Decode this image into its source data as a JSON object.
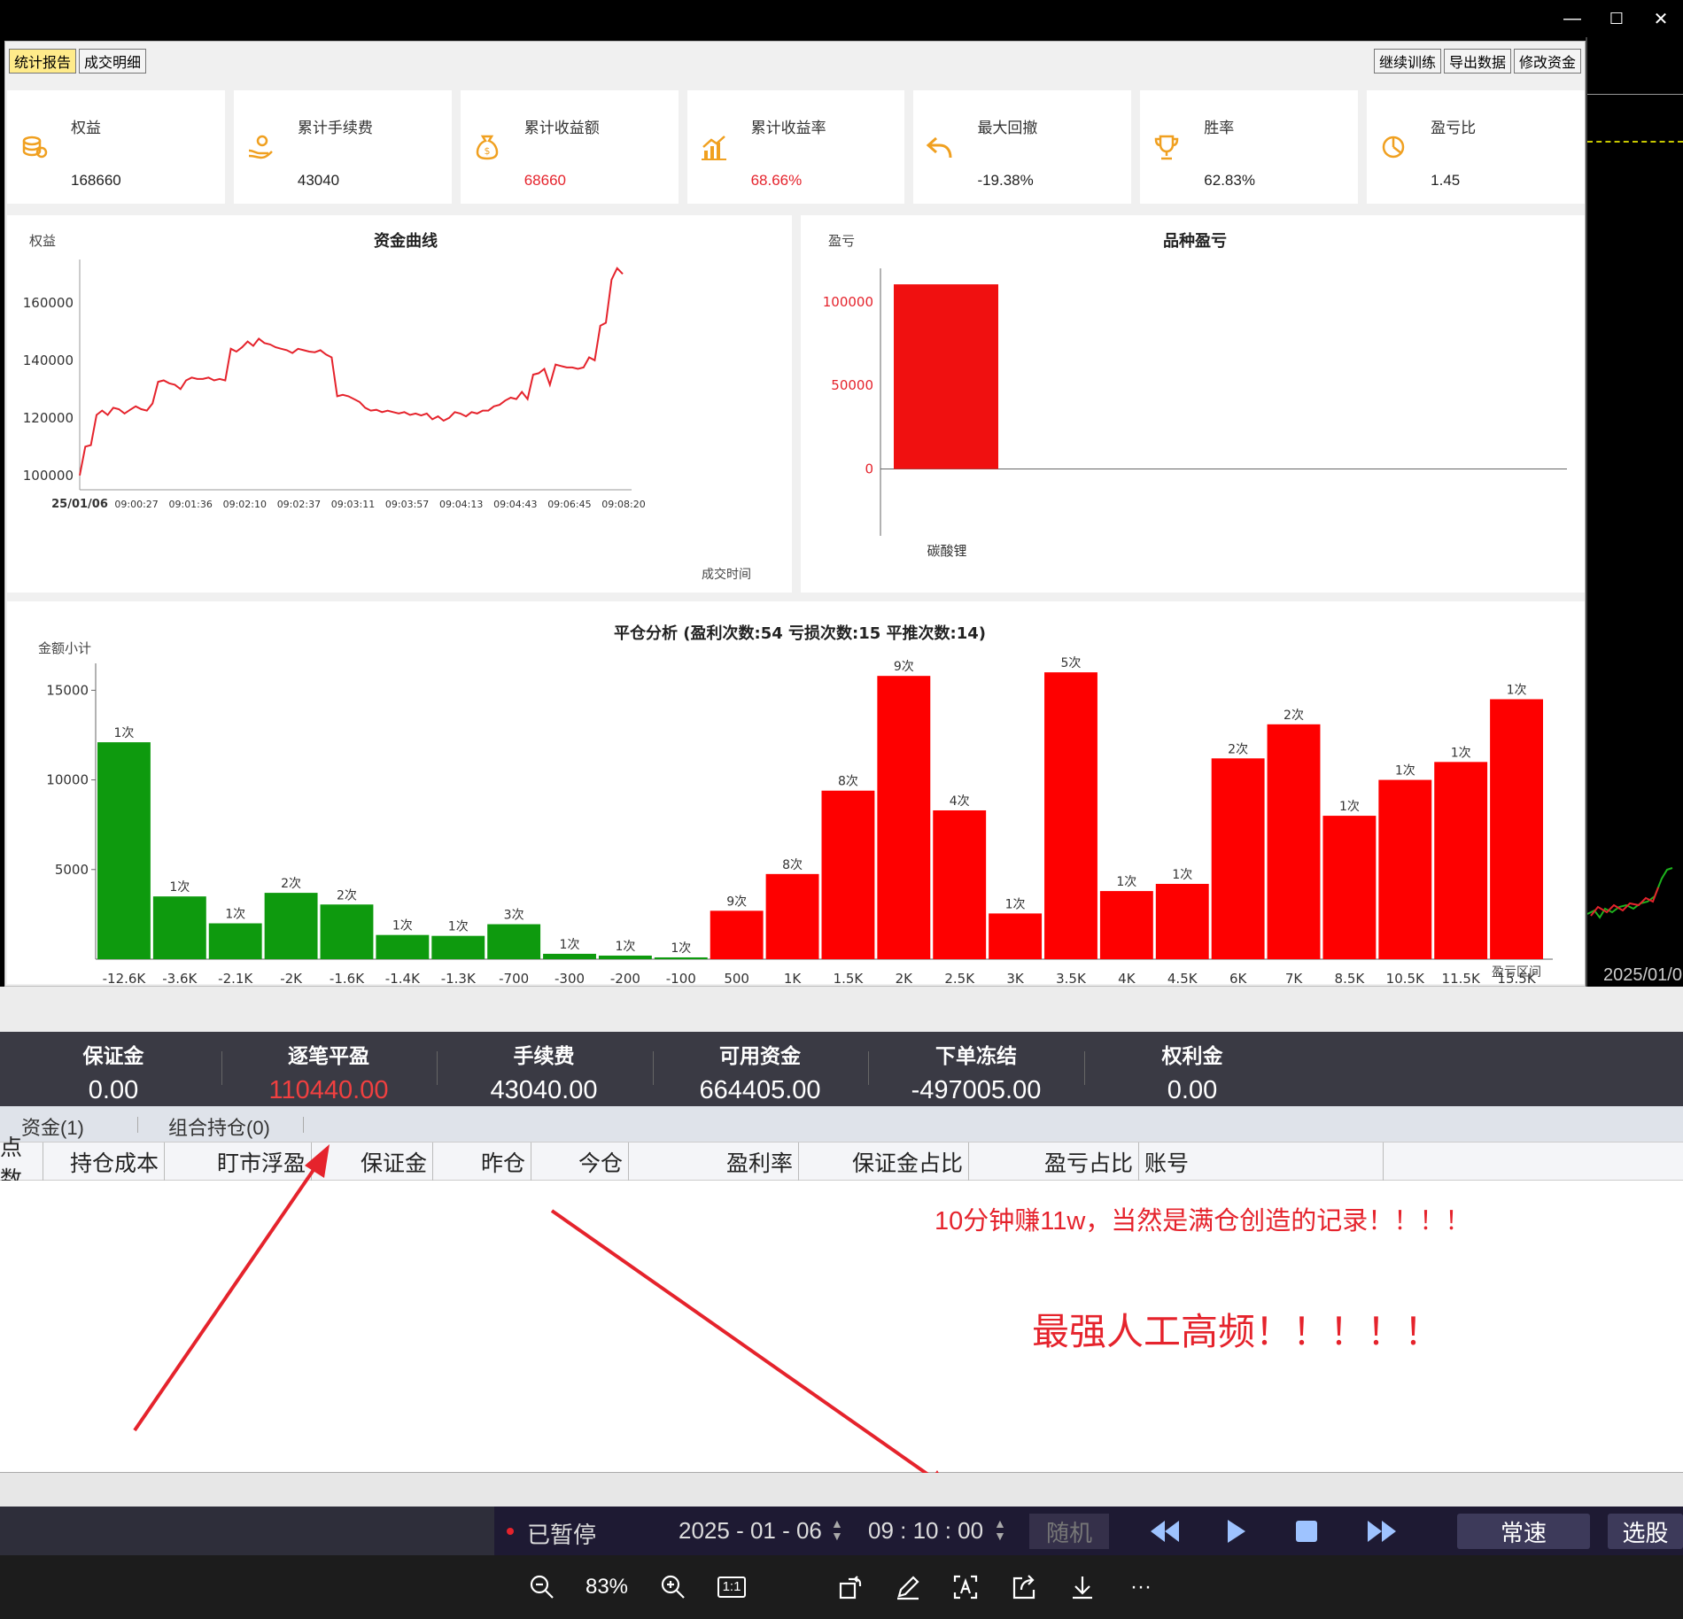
{
  "window": {
    "minimize": "—",
    "maximize": "☐",
    "close": "✕"
  },
  "side": {
    "date": "2025/01/0"
  },
  "report": {
    "tabs": [
      "统计报告",
      "成交明细"
    ],
    "actions": [
      "继续训练",
      "导出数据",
      "修改资金"
    ],
    "stats": [
      {
        "label": "权益",
        "value": "168660",
        "icon": "coins-icon",
        "red": false
      },
      {
        "label": "累计手续费",
        "value": "43040",
        "icon": "hand-coins-icon",
        "red": false
      },
      {
        "label": "累计收益额",
        "value": "68660",
        "icon": "money-bag-icon",
        "red": true
      },
      {
        "label": "累计收益率",
        "value": "68.66%",
        "icon": "growth-chart-icon",
        "red": true
      },
      {
        "label": "最大回撤",
        "value": "-19.38%",
        "icon": "undo-arrow-icon",
        "red": false
      },
      {
        "label": "胜率",
        "value": "62.83%",
        "icon": "trophy-icon",
        "red": false
      },
      {
        "label": "盈亏比",
        "value": "1.45",
        "icon": "pie-icon",
        "red": false
      }
    ],
    "accent": "#f0a020"
  },
  "chart_data": [
    {
      "type": "line",
      "title": "资金曲线",
      "ylabel": "权益",
      "xlabel": "成交时间",
      "ylim": [
        95000,
        175000
      ],
      "yticks": [
        100000,
        120000,
        140000,
        160000
      ],
      "xticks": [
        "25/01/06",
        "09:00:27",
        "09:01:36",
        "09:02:10",
        "09:02:37",
        "09:03:11",
        "09:03:57",
        "09:04:13",
        "09:04:43",
        "09:06:45",
        "09:08:20"
      ],
      "color": "#e5232c",
      "values": [
        100000,
        110000,
        110500,
        121000,
        122500,
        121000,
        123500,
        123000,
        121500,
        122800,
        124000,
        123000,
        122500,
        125000,
        132500,
        133000,
        132000,
        131500,
        130000,
        133000,
        134000,
        133500,
        133500,
        134000,
        133000,
        133500,
        133000,
        144000,
        143000,
        144500,
        146500,
        145000,
        147500,
        146000,
        145500,
        144500,
        144000,
        143500,
        142500,
        144000,
        143500,
        143000,
        142800,
        143500,
        142000,
        141000,
        127500,
        128000,
        127500,
        126500,
        125500,
        123500,
        122500,
        122800,
        122000,
        122500,
        122000,
        121500,
        122000,
        121000,
        121500,
        120800,
        121500,
        119500,
        120500,
        119000,
        120000,
        122000,
        121500,
        120500,
        122000,
        121500,
        122500,
        122500,
        124000,
        124500,
        126000,
        127000,
        126500,
        129000,
        126500,
        135000,
        135500,
        137000,
        131500,
        138500,
        138000,
        137500,
        137500,
        137000,
        137500,
        141000,
        140000,
        152000,
        153000,
        168000,
        172000,
        170000
      ]
    },
    {
      "type": "bar",
      "title": "品种盈亏",
      "ylabel": "盈亏",
      "categories": [
        "碳酸锂"
      ],
      "values": [
        110440
      ],
      "ylim": [
        -40000,
        120000
      ],
      "yticks": [
        0,
        50000,
        100000
      ],
      "color": "#f01010"
    },
    {
      "type": "bar",
      "title": "平仓分析 (盈利次数:54 亏损次数:15 平推次数:14)",
      "ylabel": "金额小计",
      "xlabel": "盈亏区间",
      "ylim": [
        0,
        16500
      ],
      "yticks": [
        5000,
        10000,
        15000
      ],
      "categories": [
        "-12.6K",
        "-3.6K",
        "-2.1K",
        "-2K",
        "-1.6K",
        "-1.4K",
        "-1.3K",
        "-700",
        "-300",
        "-200",
        "-100",
        "500",
        "1K",
        "1.5K",
        "2K",
        "2.5K",
        "3K",
        "3.5K",
        "4K",
        "4.5K",
        "6K",
        "7K",
        "8.5K",
        "10.5K",
        "11.5K",
        "15.5K"
      ],
      "values": [
        12100,
        3500,
        2000,
        3700,
        3050,
        1350,
        1300,
        1950,
        300,
        200,
        100,
        2700,
        4750,
        9400,
        15800,
        8300,
        2550,
        16000,
        3800,
        4200,
        11200,
        13100,
        8000,
        10000,
        11000,
        14500
      ],
      "counts": [
        "1次",
        "1次",
        "1次",
        "2次",
        "2次",
        "1次",
        "1次",
        "3次",
        "1次",
        "1次",
        "1次",
        "9次",
        "8次",
        "8次",
        "9次",
        "4次",
        "1次",
        "5次",
        "1次",
        "1次",
        "2次",
        "2次",
        "1次",
        "1次",
        "1次",
        "1次"
      ],
      "loss_color": "#0e9a0e",
      "gain_color": "#fe0000"
    }
  ],
  "summary": [
    {
      "label": "保证金",
      "value": "0.00",
      "red": false
    },
    {
      "label": "逐笔平盈",
      "value": "110440.00",
      "red": true
    },
    {
      "label": "手续费",
      "value": "43040.00",
      "red": false
    },
    {
      "label": "可用资金",
      "value": "664405.00",
      "red": false
    },
    {
      "label": "下单冻结",
      "value": "-497005.00",
      "red": false
    },
    {
      "label": "权利金",
      "value": "0.00",
      "red": false
    }
  ],
  "bottom_tabs": [
    "资金(1)",
    "组合持仓(0)"
  ],
  "columns": [
    "点数",
    "持仓成本",
    "盯市浮盈",
    "保证金",
    "昨仓",
    "今仓",
    "盈利率",
    "保证金占比",
    "盈亏占比",
    "账号"
  ],
  "annotations": {
    "line1": "10分钟赚11w，当然是满仓创造的记录！！！！",
    "line2": "最强人工高频！！！！！"
  },
  "playbar": {
    "status": "已暂停",
    "date": "2025 - 01 - 06",
    "time": "09 : 10 : 00",
    "random": "随机",
    "speed": "常速",
    "pick": "选股"
  },
  "viewer": {
    "zoom": "83%",
    "one_to_one": "1:1",
    "more": "···"
  }
}
